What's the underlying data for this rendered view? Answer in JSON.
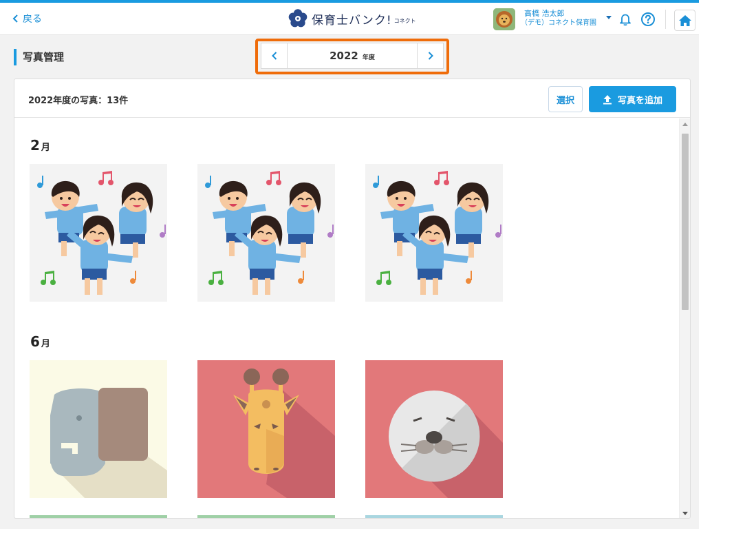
{
  "header": {
    "back_label": "戻る",
    "logo_name": "保育士バンク!",
    "logo_sub": "コネクト",
    "user_name": "高橋 浩太郎",
    "user_org": "（デモ）コネクト保育園"
  },
  "page": {
    "title": "写真管理"
  },
  "year_nav": {
    "year": "2022",
    "unit": "年度"
  },
  "panel": {
    "count_text": "2022年度の写真：13件",
    "select_label": "選択",
    "add_label": "写真を追加"
  },
  "months": [
    {
      "number": "2",
      "unit": "月",
      "photos": [
        "kids-dancing",
        "kids-dancing",
        "kids-dancing"
      ]
    },
    {
      "number": "6",
      "unit": "月",
      "photos": [
        "elephant",
        "giraffe",
        "seal"
      ]
    }
  ],
  "colors": {
    "accent": "#1a9be0",
    "highlight_outline": "#ef6c0a",
    "logo_navy": "#1c2c56"
  }
}
